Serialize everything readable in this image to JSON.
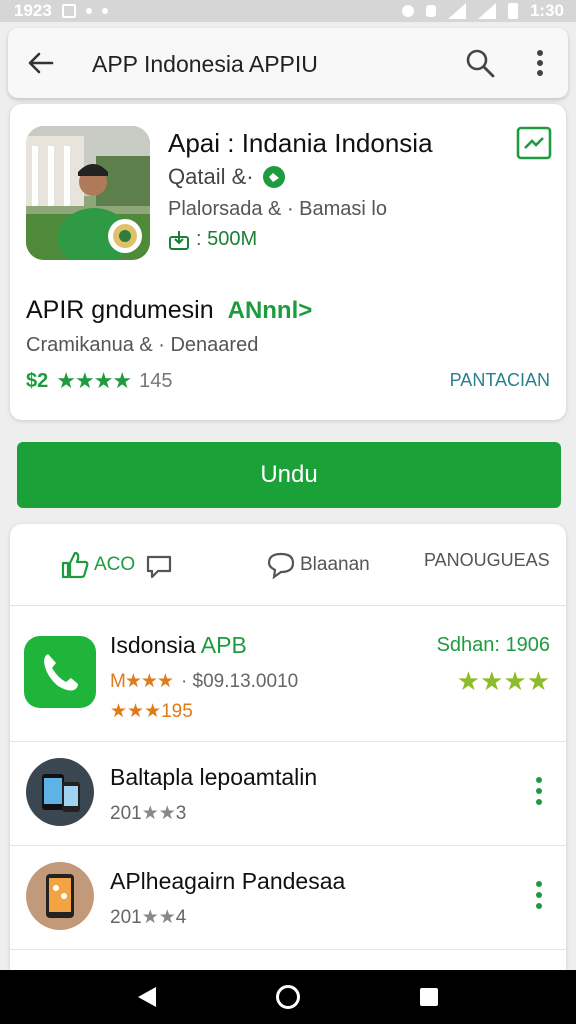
{
  "status_bar": {
    "time_left": "1923",
    "time_right": "1:30"
  },
  "search": {
    "query": "APP Indonesia APPIU"
  },
  "app": {
    "title": "Apai : Indania Indonsia",
    "developer": "Qatail &·",
    "category": "Plalorsada & · Bamasi lo",
    "downloads": ": 500M",
    "subtitle": "APIR gndumesin",
    "subtitle_tag": "ANnnl>",
    "sub_meta": "Cramikanua & · Denaared",
    "price": "$2",
    "stars": "★★★★",
    "rating_count": "145",
    "details_link": "PANTACIAN"
  },
  "install_button": "Undu",
  "actions": {
    "like": "ACO",
    "share": "Blaanan",
    "languages": "PANOUGUEAS"
  },
  "list": [
    {
      "title_a": "Isdonsia",
      "title_b": "APB",
      "meta_stars": "M★★★",
      "meta_price": "· $09.13.0010",
      "meta_stars2": "★★★",
      "meta_year": "195",
      "right_label": "Sdhan: 1906",
      "right_stars": "★★★★"
    },
    {
      "title": "Baltapla lepoamtalin",
      "meta_year": "201",
      "meta_stars": "★★",
      "meta_num": "3"
    },
    {
      "title": "APlheagairn Pandesaa",
      "meta_year": "201",
      "meta_stars": "★★",
      "meta_num": "4"
    }
  ],
  "colors": {
    "accent": "#1aa138",
    "link": "#2a7f91"
  }
}
